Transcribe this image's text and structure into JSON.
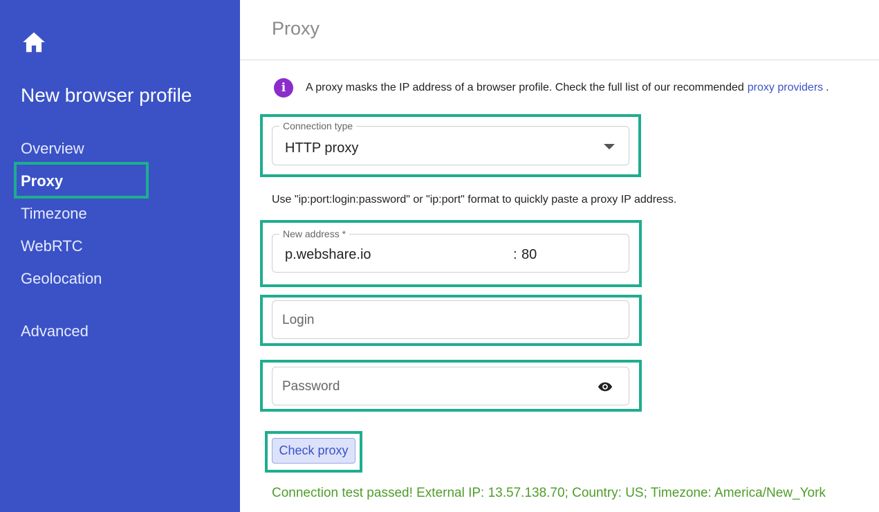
{
  "sidebar": {
    "home_icon": "home-icon",
    "title": "New browser profile",
    "items": [
      {
        "label": "Overview",
        "active": false
      },
      {
        "label": "Proxy",
        "active": true
      },
      {
        "label": "Timezone",
        "active": false
      },
      {
        "label": "WebRTC",
        "active": false
      },
      {
        "label": "Geolocation",
        "active": false
      },
      {
        "label": "Advanced",
        "active": false
      }
    ]
  },
  "header": {
    "title": "Proxy"
  },
  "info": {
    "icon": "info-icon",
    "text": "A proxy masks the IP address of a browser profile. Check the full list of our recommended",
    "link": "proxy providers",
    "end": "."
  },
  "connection_type": {
    "label": "Connection type",
    "value": "HTTP proxy"
  },
  "hint": "Use \"ip:port:login:password\" or \"ip:port\" format to quickly paste a proxy IP address.",
  "address": {
    "label": "New address *",
    "host": "p.webshare.io",
    "separator": ":",
    "port": "80"
  },
  "login": {
    "placeholder": "Login"
  },
  "password": {
    "placeholder": "Password",
    "icon": "eye-icon"
  },
  "check_button": "Check proxy",
  "status": "Connection test passed! External IP: 13.57.138.70; Country: US; Timezone: America/New_York",
  "colors": {
    "sidebar_bg": "#3a52c6",
    "highlight": "#1fad8f",
    "success": "#4f9d2a",
    "info_icon": "#8b2ccb",
    "link": "#3a52c6"
  }
}
